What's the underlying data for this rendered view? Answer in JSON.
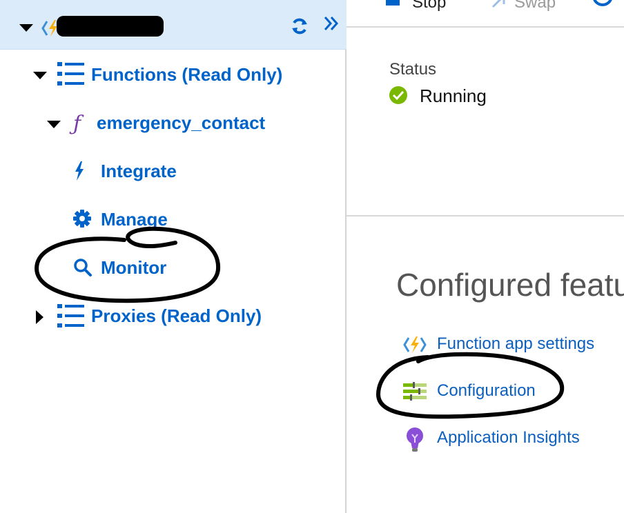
{
  "sidebar": {
    "header": {
      "app_icon": "azure-functions-bolt-icon",
      "refresh_icon": "refresh-icon",
      "collapse_icon": "double-chevron-right-icon"
    },
    "tree": {
      "functions_label": "Functions (Read Only)",
      "function_name": "emergency_contact",
      "integrate_label": "Integrate",
      "manage_label": "Manage",
      "monitor_label": "Monitor",
      "proxies_label": "Proxies (Read Only)"
    }
  },
  "toolbar": {
    "stop_label": "Stop",
    "swap_label": "Swap"
  },
  "status": {
    "heading": "Status",
    "value": "Running"
  },
  "configured_features": {
    "heading": "Configured featu",
    "links": [
      {
        "label": "Function app settings",
        "icon": "function-app-icon"
      },
      {
        "label": "Configuration",
        "icon": "sliders-icon"
      },
      {
        "label": "Application Insights",
        "icon": "lightbulb-icon"
      }
    ]
  },
  "colors": {
    "link_blue": "#0063c9",
    "header_bg": "#dcebf9",
    "running_green": "#7ab800",
    "bolt_yellow": "#f9b10a"
  }
}
